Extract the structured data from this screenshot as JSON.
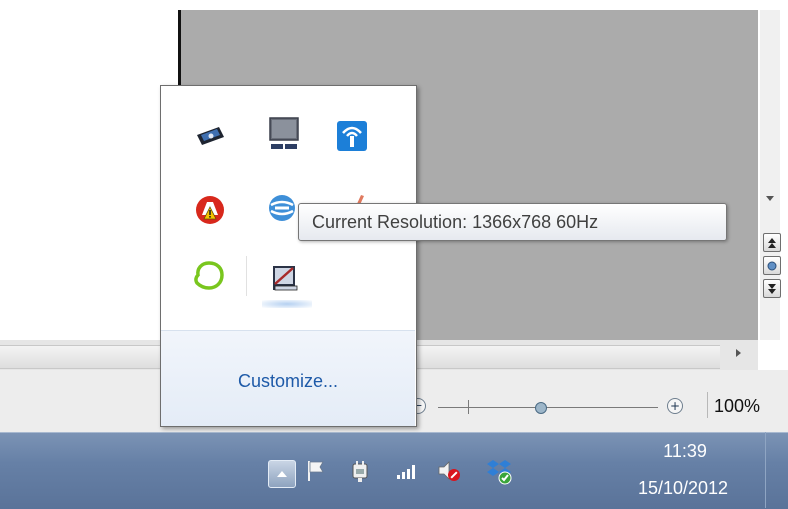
{
  "window": {
    "zoom_level": "100%",
    "zoom_out_symbol": "−",
    "zoom_in_symbol": "+",
    "zoom_fraction": 0.47
  },
  "tray_popup": {
    "icons": [
      {
        "name": "usb-drive-icon"
      },
      {
        "name": "display-monitor-icon"
      },
      {
        "name": "wireless-network-icon"
      },
      {
        "name": "security-warning-icon"
      },
      {
        "name": "network-globe-icon"
      },
      {
        "name": "pen-tool-icon"
      },
      {
        "name": "chat-app-icon"
      },
      {
        "name": "display-settings-icon"
      }
    ],
    "customize_label": "Customize..."
  },
  "tooltip": {
    "text": "Current Resolution: 1366x768 60Hz"
  },
  "taskbar": {
    "tray_icons": [
      "action-center-flag-icon",
      "power-plug-icon",
      "signal-strength-icon",
      "volume-muted-icon",
      "dropbox-synced-icon"
    ],
    "clock_time": "11:39",
    "clock_date": "15/10/2012"
  },
  "colors": {
    "taskbar": "#6680a6",
    "link": "#1e5aa8",
    "mute_red": "#d9141e",
    "dropbox_blue": "#2f7fd6"
  }
}
